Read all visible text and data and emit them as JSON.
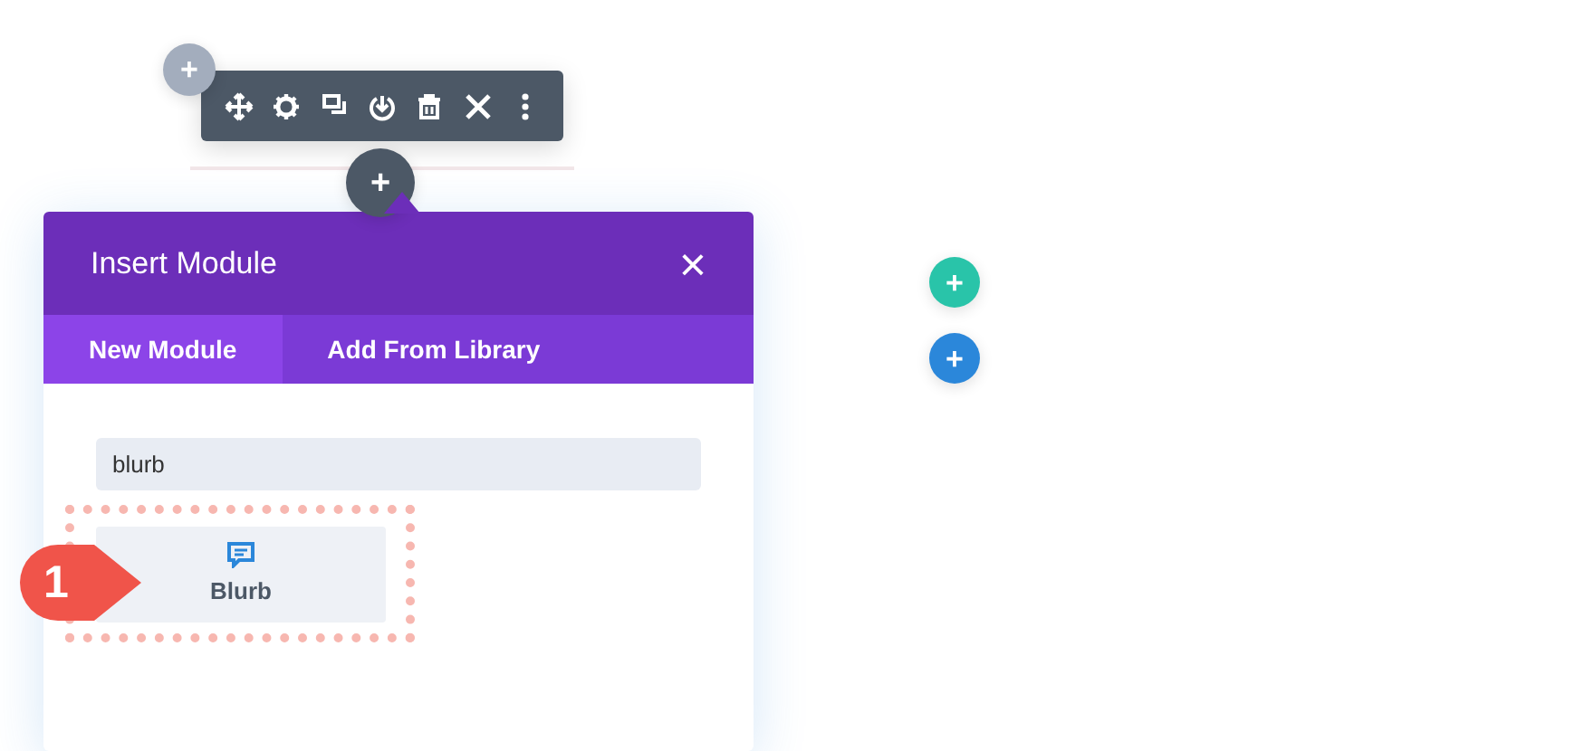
{
  "add_buttons": [
    {
      "label": "+",
      "color": "#a3adbd"
    },
    {
      "label": "+",
      "color": "#4c5866"
    },
    {
      "label": "+",
      "color": "#29c4a9"
    },
    {
      "label": "+",
      "color": "#2b87da"
    }
  ],
  "modal": {
    "title": "Insert Module",
    "close": "×",
    "tabs": [
      {
        "label": "New Module",
        "selected": true
      },
      {
        "label": "Add From Library",
        "selected": false
      }
    ],
    "search": {
      "value": "blurb"
    },
    "modules": [
      {
        "label": "Blurb",
        "highlighted": true
      }
    ]
  },
  "callout": {
    "label": "1"
  }
}
